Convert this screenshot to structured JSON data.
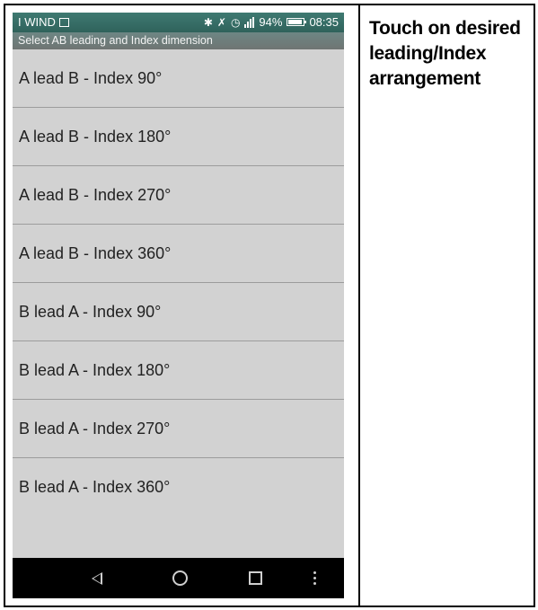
{
  "status_bar": {
    "carrier": "I WIND",
    "battery_percent": "94%",
    "battery_level": 0.94,
    "time": "08:35",
    "icons": [
      "sim-icon",
      "bluetooth-icon",
      "vibrate-icon",
      "alarm-icon",
      "signal-icon",
      "battery-icon"
    ]
  },
  "header": {
    "subtitle": "Select AB leading and Index dimension"
  },
  "options": [
    {
      "label": "A lead B - Index 90°"
    },
    {
      "label": "A lead B - Index 180°"
    },
    {
      "label": "A lead B - Index 270°"
    },
    {
      "label": "A lead B - Index 360°"
    },
    {
      "label": "B lead A - Index 90°"
    },
    {
      "label": "B lead A - Index 180°"
    },
    {
      "label": "B lead A - Index 270°"
    },
    {
      "label": "B lead A - Index 360°"
    }
  ],
  "nav_bar": {
    "icons": [
      "back-icon",
      "home-icon",
      "recents-icon",
      "menu-icon"
    ]
  },
  "instruction": {
    "text": "Touch on desired leading/Index arrangement"
  },
  "colors": {
    "status_bar": "#2f625b",
    "list_background": "#d2d2d2",
    "nav_bar": "#000000"
  }
}
